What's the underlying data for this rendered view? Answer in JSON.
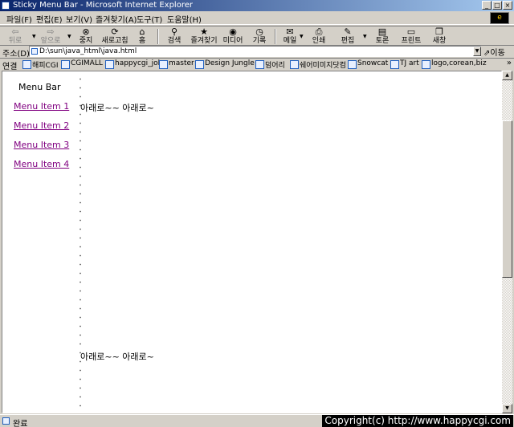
{
  "window": {
    "title": "Sticky Menu Bar - Microsoft Internet Explorer",
    "ie_logo": "e"
  },
  "menubar": {
    "items": [
      "파일(F)",
      "편집(E)",
      "보기(V)",
      "즐겨찾기(A)",
      "도구(T)",
      "도움말(H)"
    ]
  },
  "toolbar": {
    "buttons": [
      {
        "label": "뒤로",
        "icon": "back-arrow-icon",
        "glyph": "⇦",
        "enabled": false
      },
      {
        "label": "앞으로",
        "icon": "forward-arrow-icon",
        "glyph": "⇨",
        "enabled": false
      },
      {
        "label": "중지",
        "icon": "stop-icon",
        "glyph": "⊗",
        "enabled": true
      },
      {
        "label": "새로고침",
        "icon": "refresh-icon",
        "glyph": "⟳",
        "enabled": true
      },
      {
        "label": "홈",
        "icon": "home-icon",
        "glyph": "⌂",
        "enabled": true
      },
      {
        "label": "검색",
        "icon": "search-icon",
        "glyph": "⚲",
        "enabled": true
      },
      {
        "label": "즐겨찾기",
        "icon": "favorites-icon",
        "glyph": "★",
        "enabled": true
      },
      {
        "label": "미디어",
        "icon": "media-icon",
        "glyph": "◉",
        "enabled": true
      },
      {
        "label": "기록",
        "icon": "history-icon",
        "glyph": "◷",
        "enabled": true
      },
      {
        "label": "메일",
        "icon": "mail-icon",
        "glyph": "✉",
        "enabled": true
      },
      {
        "label": "인쇄",
        "icon": "print-icon",
        "glyph": "⎙",
        "enabled": true
      },
      {
        "label": "편집",
        "icon": "edit-icon",
        "glyph": "✎",
        "enabled": true
      },
      {
        "label": "토론",
        "icon": "discuss-icon",
        "glyph": "▤",
        "enabled": true
      },
      {
        "label": "프린트",
        "icon": "printer-icon",
        "glyph": "▭",
        "enabled": true
      },
      {
        "label": "새창",
        "icon": "new-window-icon",
        "glyph": "❐",
        "enabled": true
      }
    ]
  },
  "address": {
    "label": "주소(D)",
    "value": "D:\\sun\\java_html\\java.html",
    "go_label": "이동"
  },
  "links": {
    "label": "연결",
    "items": [
      "해피CGI",
      "CGIMALL",
      "happycgi_job",
      "master",
      "Design Jungle",
      "덤어리",
      "쉐어미미지닷컴",
      "Snowcat",
      "TJ art",
      "logo,corean,biz"
    ]
  },
  "page": {
    "menu_title": "Menu Bar",
    "menu_items": [
      "Menu Item 1",
      "Menu Item 2",
      "Menu Item 3",
      "Menu Item 4"
    ],
    "body_text_top": "아래로~~ 아래로~",
    "body_text_bottom": "아래로~~ 아래로~"
  },
  "status": {
    "text": "완료",
    "copyright": "Copyright(c) http://www.happycgi.com"
  },
  "colors": {
    "title_gradient_start": "#0a246a",
    "title_gradient_end": "#a6caf0",
    "visited_link": "#800080",
    "chrome": "#d4d0c8"
  }
}
